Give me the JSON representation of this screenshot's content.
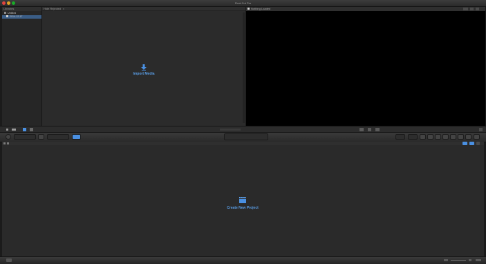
{
  "window": {
    "title": "Final Cut Pro",
    "traffic_colors": [
      "#e0443e",
      "#dea123",
      "#1aab29"
    ]
  },
  "libraries": {
    "header": "Libraries",
    "items": [
      {
        "label": "Untitled"
      },
      {
        "label": "2014-12-17"
      }
    ]
  },
  "browser": {
    "header": "Hide Rejected",
    "import_label": "Import Media"
  },
  "viewer": {
    "header": "Nothing Loaded"
  },
  "timeline": {
    "create_label": "Create New Project"
  },
  "colors": {
    "accent": "#4a90e2",
    "selection": "#3a5d86"
  },
  "icons": {
    "import": "down-arrow-icon",
    "clapper": "clapperboard-icon"
  }
}
